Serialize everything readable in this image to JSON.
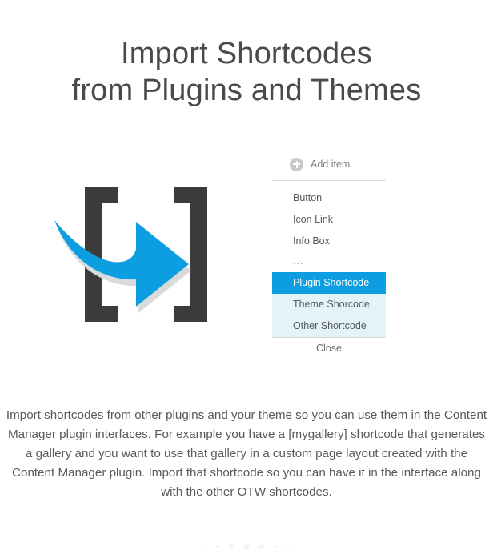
{
  "heading": {
    "line1": "Import Shortcodes",
    "line2": "from Plugins and Themes"
  },
  "illustration": {
    "name": "shortcode-brackets-arrow-graphic",
    "bracket_color": "#3b3b3b",
    "arrow_color": "#0c9ee0",
    "arrow_shadow_color": "#d8dadb"
  },
  "panel": {
    "add_item_label": "Add item",
    "add_icon": "plus-circle-icon",
    "items": [
      {
        "label": "Button",
        "state": "normal"
      },
      {
        "label": "Icon Link",
        "state": "normal"
      },
      {
        "label": "Info Box",
        "state": "normal"
      },
      {
        "label": "...",
        "state": "ellipsis"
      },
      {
        "label": "Plugin Shortcode",
        "state": "selected"
      },
      {
        "label": "Theme Shorcode",
        "state": "tinted"
      },
      {
        "label": "Other Shortcode",
        "state": "tinted"
      }
    ],
    "close_label": "Close",
    "selected_bg": "#0c9ee0",
    "tinted_bg": "#e2f4fa"
  },
  "body": {
    "paragraph": "Import shortcodes from other plugins and your theme so you can use them in the Content Manager plugin interfaces. For example you have a [mygallery] shortcode that generates a gallery and you want to use that gallery in a custom page layout created with the Content Manager plugin. Import that shortcode so you can have it in the interface along with the other OTW shortcodes."
  },
  "pagination": {
    "dot_color": "#f4f4f4",
    "dots": [
      "s1",
      "s2",
      "s3",
      "s4",
      "s3",
      "s2",
      "s1"
    ]
  }
}
